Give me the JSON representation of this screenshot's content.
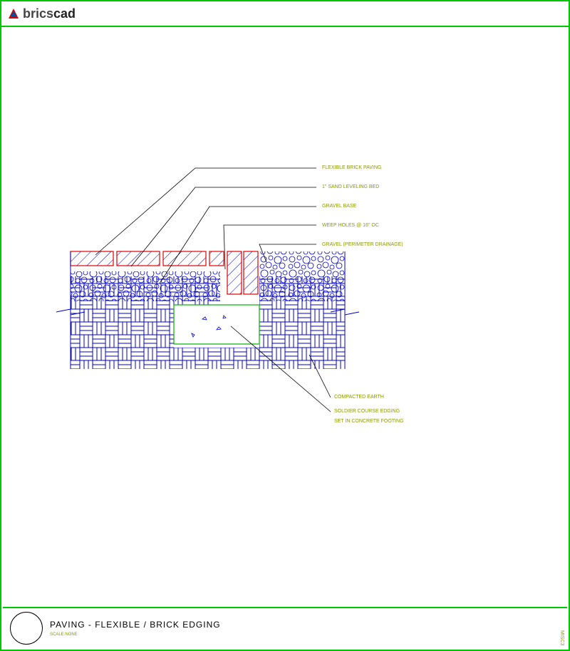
{
  "brand": {
    "plain": "brics",
    "bold": "cad"
  },
  "labels": {
    "l1": "FLEXIBLE BRICK PAVING",
    "l2": "1\" SAND LEVELING BED",
    "l3": "GRAVEL BASE",
    "l4": "WEEP HOLES @ 16\" OC",
    "l5": "GRAVEL (PERIMETER DRAINAGE)",
    "l6": "COMPACTED EARTH",
    "l7a": "SOLDIER COURSE EDGING",
    "l7b": "SET IN CONCRETE FOOTING"
  },
  "footer": {
    "title": "PAVING - FLEXIBLE / BRICK EDGING",
    "scale": "SCALE:NONE"
  },
  "side_code": "MISC3"
}
